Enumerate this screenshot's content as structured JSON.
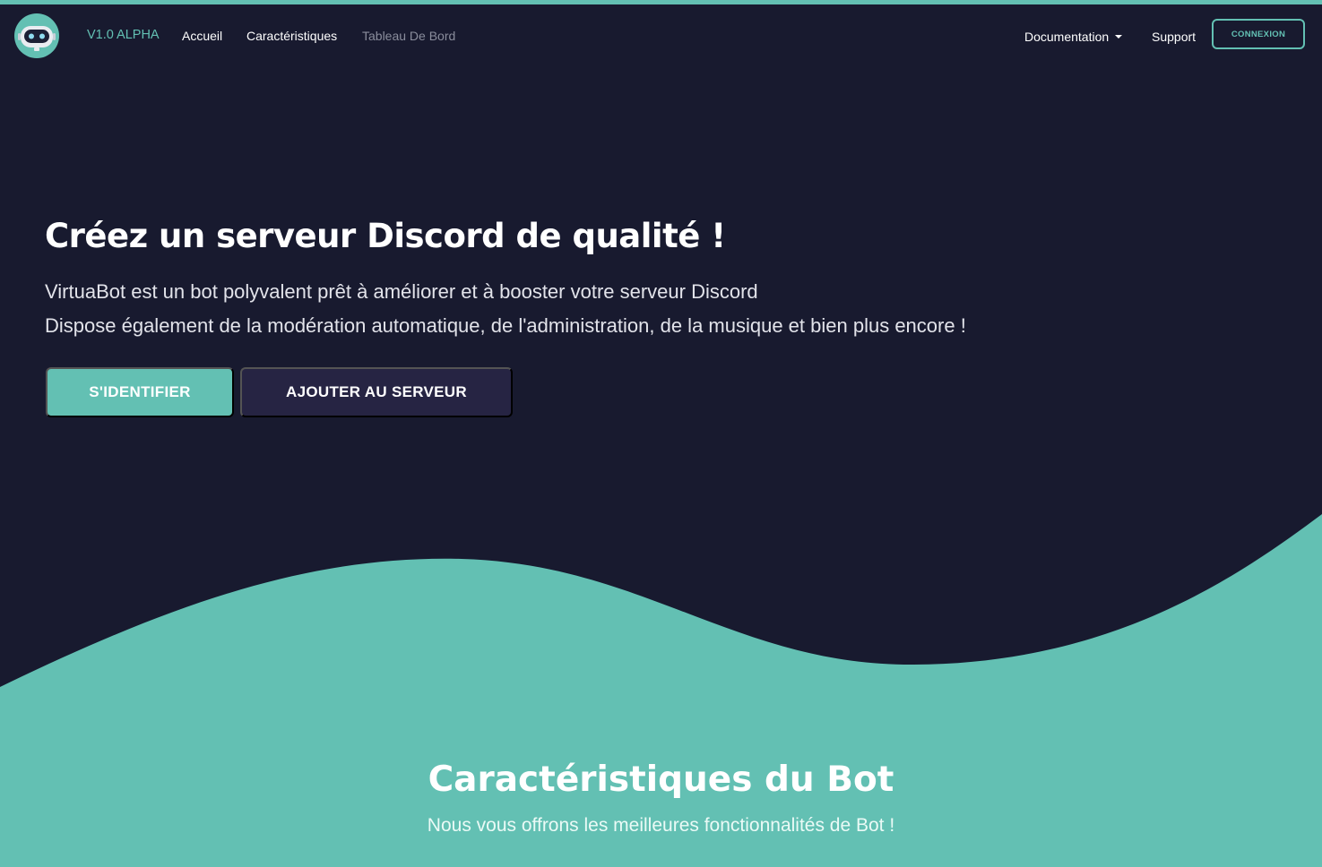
{
  "colors": {
    "accent": "#63c0b3",
    "background": "#181a2f",
    "secondary_button": "#262443",
    "muted_link": "#8a8d9c"
  },
  "navbar": {
    "logo_icon": "robot-icon",
    "version_label": "V1.0 ALPHA",
    "links": [
      {
        "label": "Accueil"
      },
      {
        "label": "Caractéristiques"
      },
      {
        "label": "Tableau De Bord"
      }
    ],
    "documentation_label": "Documentation",
    "documentation_icon": "caret-down-icon",
    "support_label": "Support",
    "login_label": "CONNEXION"
  },
  "hero": {
    "title": "Créez un serveur Discord de qualité !",
    "description_lines": [
      "VirtuaBot est un bot polyvalent prêt à améliorer et à booster votre serveur Discord",
      "Dispose également de la modération automatique, de l'administration, de la musique et bien plus encore !"
    ],
    "primary_button": "S'IDENTIFIER",
    "secondary_button": "AJOUTER AU SERVEUR"
  },
  "features": {
    "title": "Caractéristiques du Bot",
    "subtitle": "Nous vous offrons les meilleures fonctionnalités de Bot !"
  }
}
